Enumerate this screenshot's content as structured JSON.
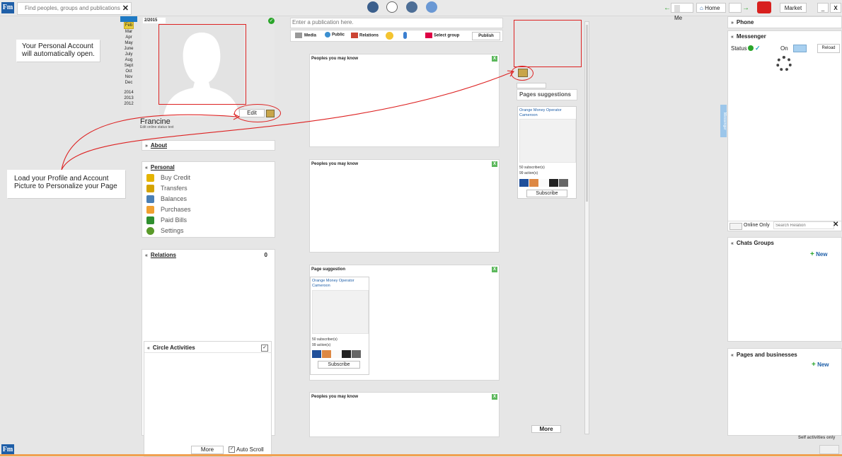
{
  "topbar": {
    "search_placeholder": "Find peoples, groups and publications",
    "me_label": "Me",
    "home_label": "Home",
    "market_label": "Market",
    "min_label": "_",
    "close_label": "X"
  },
  "calendar": {
    "current_label": "2/2015",
    "months": [
      "Jan",
      "Feb",
      "Mar",
      "Apr",
      "May",
      "June",
      "July",
      "Aug",
      "Sept",
      "Oct",
      "Nov",
      "Dec"
    ],
    "years": [
      "2014",
      "2013",
      "2012"
    ]
  },
  "profile": {
    "name": "Francine",
    "status_text": "Edit online status text",
    "edit_label": "Edit"
  },
  "annotations": {
    "personal_account": "Your Personal Account will automatically open.",
    "load_profile": "Load your Profile and Account Picture to Personalize your Page"
  },
  "about": {
    "title": "About"
  },
  "personal": {
    "title": "Personal",
    "items": [
      {
        "label": "Buy Credit",
        "icon": "dollar-icon",
        "color": "#e4b400"
      },
      {
        "label": "Transfers",
        "icon": "transfer-icon",
        "color": "#d4a300"
      },
      {
        "label": "Balances",
        "icon": "scale-icon",
        "color": "#4a7fb5"
      },
      {
        "label": "Purchases",
        "icon": "cart-icon",
        "color": "#f0a030"
      },
      {
        "label": "Paid Bills",
        "icon": "bill-icon",
        "color": "#2f8f2f"
      },
      {
        "label": "Settings",
        "icon": "gear-icon",
        "color": "#5a9a2a"
      }
    ]
  },
  "relations": {
    "title": "Relations",
    "count": "0"
  },
  "circle": {
    "title": "Circle Activities",
    "more_label": "More",
    "autoscroll_label": "Auto Scroll"
  },
  "publisher": {
    "placeholder": "Enter a publication here.",
    "media": "Media",
    "public": "Public",
    "relations": "Relations",
    "select_group": "Select group",
    "publish": "Publish"
  },
  "feed": {
    "cards": [
      {
        "title": "Peoples you may know"
      },
      {
        "title": "Peoples you may know"
      },
      {
        "title": "Page suggestion"
      },
      {
        "title": "Peoples you may know"
      }
    ],
    "close_label": "X"
  },
  "suggestion": {
    "name": "Orange Money Operator Cameroon",
    "subscribers": "50 subscriber(s)",
    "actions": "99 action(s)",
    "subscribe": "Subscribe"
  },
  "pages_suggestions": {
    "title": "Pages suggestions",
    "more_label": "More"
  },
  "right": {
    "phone": "Phone",
    "messenger": "Messenger",
    "status_label": "Status",
    "on_label": "On",
    "reload": "Reload",
    "online_only": "Online Only",
    "search_relation_placeholder": "Search Relation",
    "chats_groups": "Chats Groups",
    "new_label": "New",
    "pages_businesses": "Pages and businesses",
    "self_activities": "Self activities only",
    "side_tab": "Messenger"
  },
  "colors": {
    "accent": "#1f5fa8",
    "annotation_red": "#dd2222",
    "green": "#2aa52a"
  }
}
